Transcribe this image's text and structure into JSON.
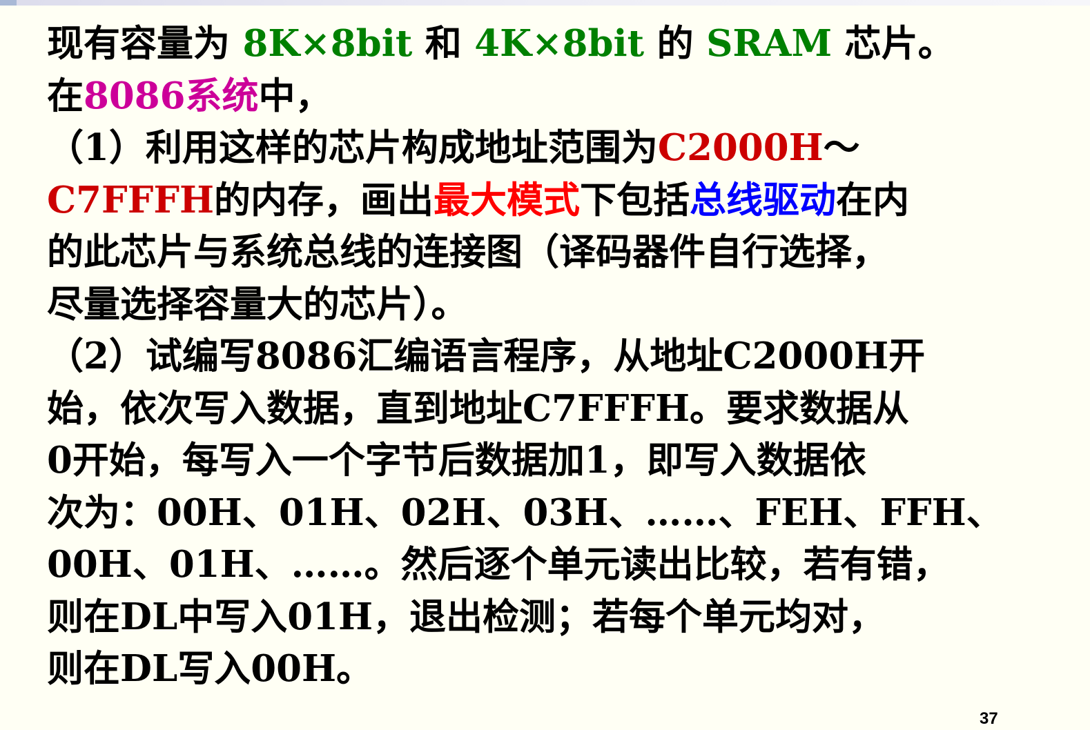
{
  "lines": [
    {
      "segments": [
        {
          "text": "现有容量为 "
        },
        {
          "text": "8K×8bit",
          "color": "#008000"
        },
        {
          "text": " 和 "
        },
        {
          "text": "4K×8bit",
          "color": "#008000"
        },
        {
          "text": " 的 "
        },
        {
          "text": "SRAM",
          "color": "#008000"
        },
        {
          "text": " 芯片。"
        }
      ]
    },
    {
      "segments": [
        {
          "text": "在"
        },
        {
          "text": "8086系统",
          "color": "#cc0099"
        },
        {
          "text": "中，"
        }
      ]
    },
    {
      "segments": [
        {
          "text": "（1）利用这样的芯片构成地址范围为"
        },
        {
          "text": "C2000H",
          "color": "#cc0000"
        },
        {
          "text": "～"
        }
      ]
    },
    {
      "segments": [
        {
          "text": "C7FFFH",
          "color": "#cc0000"
        },
        {
          "text": "的内存，画出"
        },
        {
          "text": "最大模式",
          "color": "#ff0000"
        },
        {
          "text": "下包括"
        },
        {
          "text": "总线驱动",
          "color": "#0000ff"
        },
        {
          "text": "在内"
        }
      ]
    },
    {
      "segments": [
        {
          "text": "的此芯片与系统总线的连接图（译码器件自行选择，"
        }
      ]
    },
    {
      "segments": [
        {
          "text": "尽量选择容量大的芯片）。"
        }
      ]
    },
    {
      "segments": [
        {
          "text": "（2）试编写8086汇编语言程序，从地址C2000H开"
        }
      ]
    },
    {
      "segments": [
        {
          "text": "始，依次写入数据，直到地址C7FFFH。要求数据从"
        }
      ]
    },
    {
      "segments": [
        {
          "text": "0开始，每写入一个字节后数据加1，即写入数据依"
        }
      ]
    },
    {
      "segments": [
        {
          "text": "次为：00H、01H、02H、03H、……、FEH、FFH、"
        }
      ]
    },
    {
      "segments": [
        {
          "text": "00H、01H、……。然后逐个单元读出比较，若有错，"
        }
      ]
    },
    {
      "segments": [
        {
          "text": "则在DL中写入01H，退出检测；若每个单元均对，"
        }
      ]
    },
    {
      "segments": [
        {
          "text": "则在DL写入00H。"
        }
      ]
    }
  ],
  "page_number": "37"
}
